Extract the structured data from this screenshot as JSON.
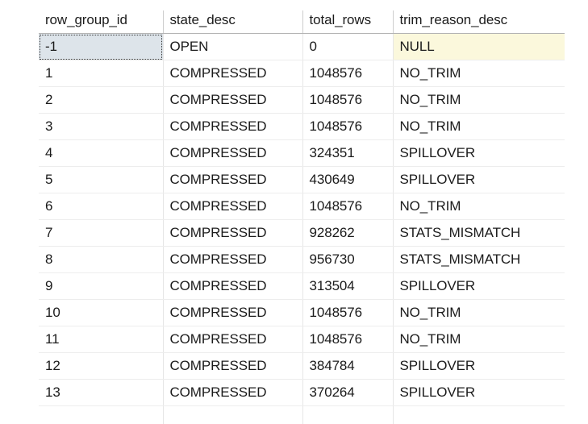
{
  "grid": {
    "columns": [
      {
        "key": "row_group_id",
        "label": "row_group_id",
        "name": "column-header-row-group-id"
      },
      {
        "key": "state_desc",
        "label": "state_desc",
        "name": "column-header-state-desc"
      },
      {
        "key": "total_rows",
        "label": "total_rows",
        "name": "column-header-total-rows"
      },
      {
        "key": "trim_reason_desc",
        "label": "trim_reason_desc",
        "name": "column-header-trim-reason-desc"
      }
    ],
    "rows": [
      {
        "row_group_id": "-1",
        "state_desc": "OPEN",
        "total_rows": "0",
        "trim_reason_desc": "NULL",
        "selected_cell": "row_group_id",
        "null_cell": "trim_reason_desc"
      },
      {
        "row_group_id": "1",
        "state_desc": "COMPRESSED",
        "total_rows": "1048576",
        "trim_reason_desc": "NO_TRIM"
      },
      {
        "row_group_id": "2",
        "state_desc": "COMPRESSED",
        "total_rows": "1048576",
        "trim_reason_desc": "NO_TRIM"
      },
      {
        "row_group_id": "3",
        "state_desc": "COMPRESSED",
        "total_rows": "1048576",
        "trim_reason_desc": "NO_TRIM"
      },
      {
        "row_group_id": "4",
        "state_desc": "COMPRESSED",
        "total_rows": "324351",
        "trim_reason_desc": "SPILLOVER"
      },
      {
        "row_group_id": "5",
        "state_desc": "COMPRESSED",
        "total_rows": "430649",
        "trim_reason_desc": "SPILLOVER"
      },
      {
        "row_group_id": "6",
        "state_desc": "COMPRESSED",
        "total_rows": "1048576",
        "trim_reason_desc": "NO_TRIM"
      },
      {
        "row_group_id": "7",
        "state_desc": "COMPRESSED",
        "total_rows": "928262",
        "trim_reason_desc": "STATS_MISMATCH"
      },
      {
        "row_group_id": "8",
        "state_desc": "COMPRESSED",
        "total_rows": "956730",
        "trim_reason_desc": "STATS_MISMATCH"
      },
      {
        "row_group_id": "9",
        "state_desc": "COMPRESSED",
        "total_rows": "313504",
        "trim_reason_desc": "SPILLOVER"
      },
      {
        "row_group_id": "10",
        "state_desc": "COMPRESSED",
        "total_rows": "1048576",
        "trim_reason_desc": "NO_TRIM"
      },
      {
        "row_group_id": "11",
        "state_desc": "COMPRESSED",
        "total_rows": "1048576",
        "trim_reason_desc": "NO_TRIM"
      },
      {
        "row_group_id": "12",
        "state_desc": "COMPRESSED",
        "total_rows": "384784",
        "trim_reason_desc": "SPILLOVER"
      },
      {
        "row_group_id": "13",
        "state_desc": "COMPRESSED",
        "total_rows": "370264",
        "trim_reason_desc": "SPILLOVER"
      }
    ],
    "colors": {
      "selected_cell_background": "#dde4ea",
      "null_cell_background": "#fbf8dc",
      "header_border": "#b4b4b4",
      "row_border": "#ededed",
      "column_border": "#e6e6e6",
      "text": "#1b1b1b",
      "grid_background": "#ffffff"
    }
  }
}
